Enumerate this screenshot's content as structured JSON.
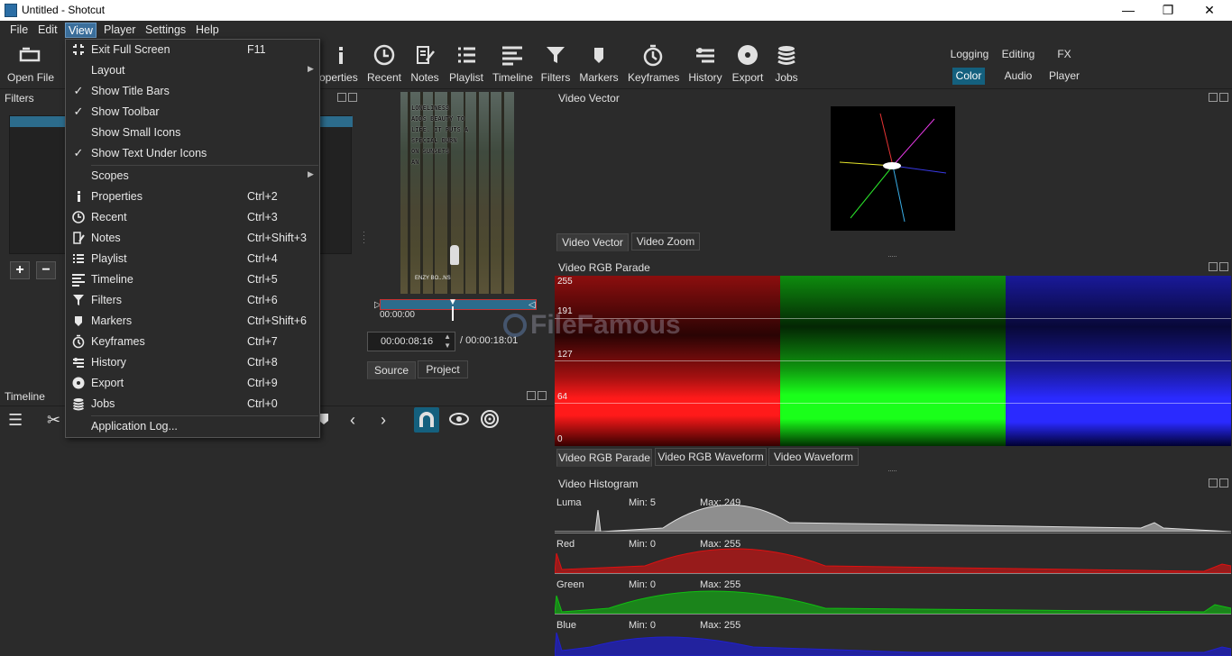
{
  "window": {
    "title": "Untitled - Shotcut",
    "minimize": "—",
    "maximize": "❐",
    "close": "✕"
  },
  "menubar": [
    "File",
    "Edit",
    "View",
    "Player",
    "Settings",
    "Help"
  ],
  "toolbar": {
    "open_file": "Open File",
    "properties": "roperties",
    "recent": "Recent",
    "notes": "Notes",
    "playlist": "Playlist",
    "timeline": "Timeline",
    "filters": "Filters",
    "markers": "Markers",
    "keyframes": "Keyframes",
    "history": "History",
    "export": "Export",
    "jobs": "Jobs"
  },
  "workspaces": {
    "logging": "Logging",
    "editing": "Editing",
    "fx": "FX",
    "color": "Color",
    "audio": "Audio",
    "player": "Player"
  },
  "panels": {
    "filters": "Filters",
    "timeline": "Timeline",
    "video_vector": "Video Vector",
    "video_rgb_parade": "Video RGB Parade",
    "video_histogram": "Video Histogram"
  },
  "player": {
    "overlay_text": "LONELINESS\nADDS BEAUTY TO\nLIFE. IT PUTS A\nSPECIAL BURN\nON SUNSETS\nAN",
    "credit": "ENZY BO...NS",
    "scrub_timecode": "00:00:00",
    "position": "00:00:08:16",
    "duration": "/ 00:00:18:01",
    "tab_source": "Source",
    "tab_project": "Project"
  },
  "scope_tabs": {
    "vector": [
      "Video Vector",
      "Video Zoom"
    ],
    "parade": [
      "Video RGB Parade",
      "Video RGB Waveform",
      "Video Waveform"
    ]
  },
  "parade": {
    "grid_labels": [
      "255",
      "191",
      "127",
      "64",
      "0"
    ],
    "colors": {
      "red": "#ff1a1a",
      "green": "#1aff1a",
      "blue": "#2a2aff"
    }
  },
  "histogram": [
    {
      "channel": "Luma",
      "min": "Min: 5",
      "max": "Max: 249",
      "color": "#e0e0e0"
    },
    {
      "channel": "Red",
      "min": "Min: 0",
      "max": "Max: 255",
      "color": "#e01010"
    },
    {
      "channel": "Green",
      "min": "Min: 0",
      "max": "Max: 255",
      "color": "#10c010"
    },
    {
      "channel": "Blue",
      "min": "Min: 0",
      "max": "Max: 255",
      "color": "#2020d0"
    }
  ],
  "watermark": "FileFamous",
  "view_menu": [
    {
      "label": "Exit Full Screen",
      "shortcut": "F11",
      "icon": "fullscreen-exit-icon"
    },
    {
      "label": "Layout",
      "shortcut": "",
      "submenu": true
    },
    {
      "label": "Show Title Bars",
      "shortcut": "",
      "checked": true
    },
    {
      "label": "Show Toolbar",
      "shortcut": "",
      "checked": true
    },
    {
      "label": "Show Small Icons",
      "shortcut": ""
    },
    {
      "label": "Show Text Under Icons",
      "shortcut": "",
      "checked": true
    },
    {
      "label": "Scopes",
      "shortcut": "",
      "submenu": true
    },
    {
      "label": "Properties",
      "shortcut": "Ctrl+2",
      "icon": "info-icon"
    },
    {
      "label": "Recent",
      "shortcut": "Ctrl+3",
      "icon": "clock-icon"
    },
    {
      "label": "Notes",
      "shortcut": "Ctrl+Shift+3",
      "icon": "notes-icon"
    },
    {
      "label": "Playlist",
      "shortcut": "Ctrl+4",
      "icon": "list-icon"
    },
    {
      "label": "Timeline",
      "shortcut": "Ctrl+5",
      "icon": "timeline-icon"
    },
    {
      "label": "Filters",
      "shortcut": "Ctrl+6",
      "icon": "funnel-icon"
    },
    {
      "label": "Markers",
      "shortcut": "Ctrl+Shift+6",
      "icon": "marker-icon"
    },
    {
      "label": "Keyframes",
      "shortcut": "Ctrl+7",
      "icon": "stopwatch-icon"
    },
    {
      "label": "History",
      "shortcut": "Ctrl+8",
      "icon": "history-icon"
    },
    {
      "label": "Export",
      "shortcut": "Ctrl+9",
      "icon": "disc-icon"
    },
    {
      "label": "Jobs",
      "shortcut": "Ctrl+0",
      "icon": "database-icon"
    },
    {
      "label": "Application Log...",
      "shortcut": ""
    }
  ]
}
